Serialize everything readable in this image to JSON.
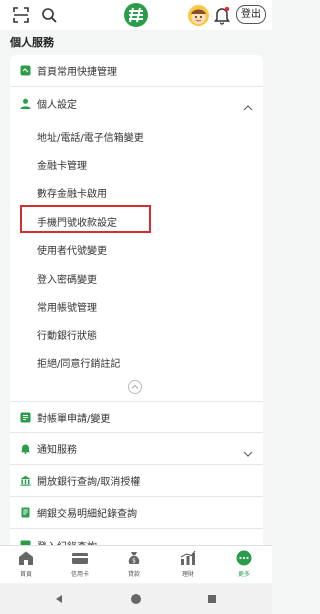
{
  "topbar": {
    "logout_label": "登出"
  },
  "page_title": "個人服務",
  "menu": {
    "quick_manage": "首頁常用快捷管理",
    "personal_settings": "個人設定",
    "sub_items": [
      "地址/電話/電子信箱變更",
      "金融卡管理",
      "數存金融卡啟用",
      "手機門號收款設定",
      "使用者代號變更",
      "登入密碼變更",
      "常用帳號管理",
      "行動銀行狀態",
      "拒絕/同意行銷註記"
    ],
    "statement": "對帳單申請/變更",
    "notify": "通知服務",
    "open_banking": "開放銀行查詢/取消授權",
    "online_tx": "網銀交易明細紀錄查詢",
    "partial": "登入紀錄查詢"
  },
  "bottom_nav": [
    {
      "label": "首頁",
      "icon": "home-icon"
    },
    {
      "label": "信用卡",
      "icon": "credit-card-icon"
    },
    {
      "label": "貸款",
      "icon": "money-bag-icon"
    },
    {
      "label": "理財",
      "icon": "chart-icon"
    },
    {
      "label": "更多",
      "icon": "more-icon"
    }
  ],
  "colors": {
    "brand_green": "#2a9d4b",
    "highlight_red": "#d42e2e"
  }
}
